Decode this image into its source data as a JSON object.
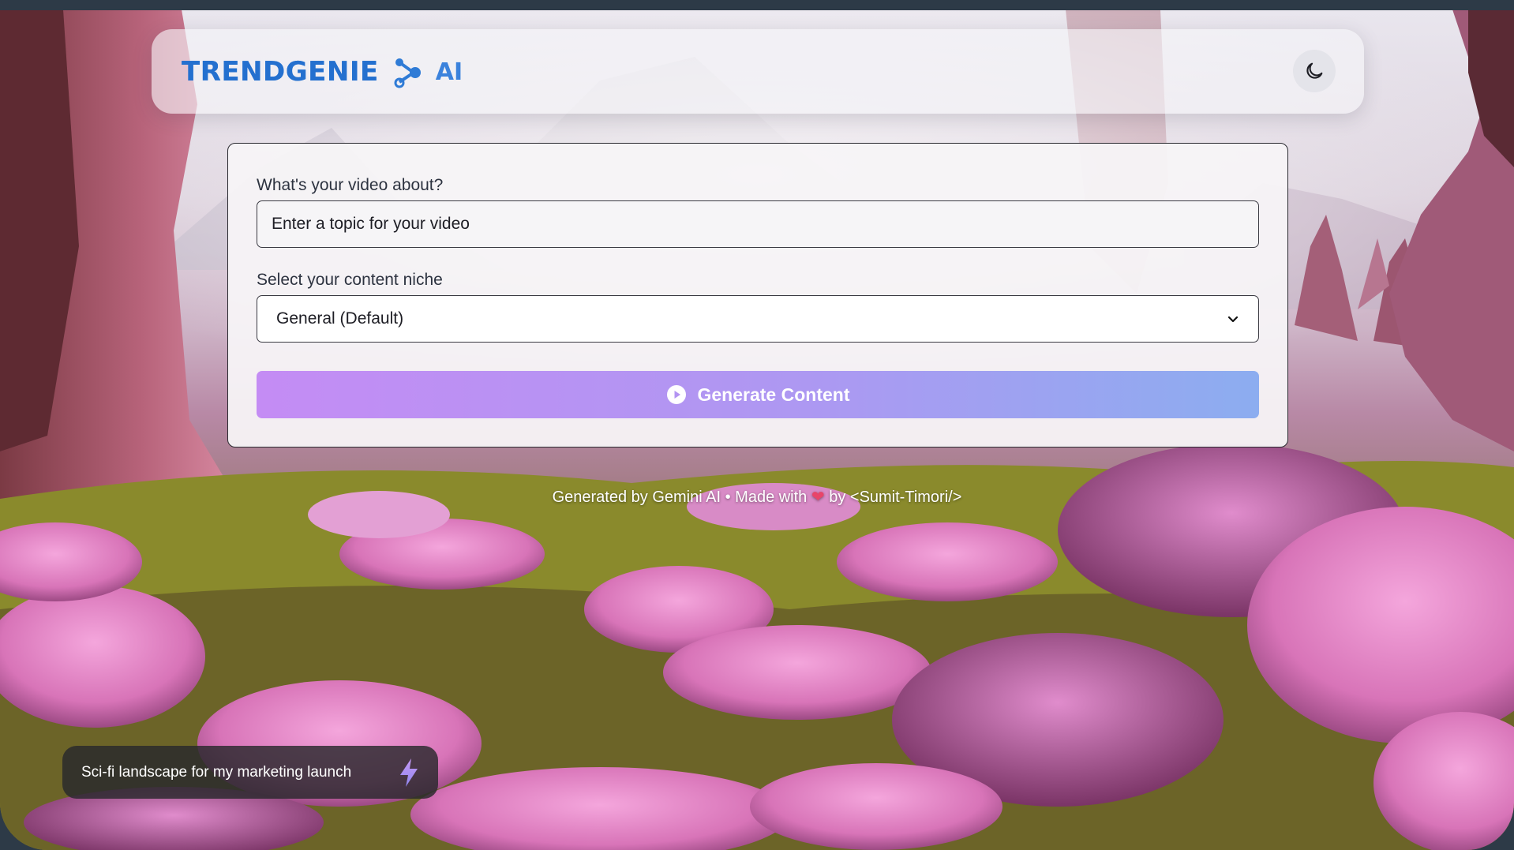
{
  "header": {
    "brand": "TRENDGENIE",
    "brand_suffix": "AI",
    "theme_toggle_icon": "moon-icon"
  },
  "form": {
    "topic_label": "What's your video about?",
    "topic_placeholder": "Enter a topic for your video",
    "topic_value": "",
    "niche_label": "Select your content niche",
    "niche_selected": "General (Default)",
    "generate_label": "Generate Content"
  },
  "footer": {
    "part1": "Generated by Gemini AI • Made with",
    "heart": "❤",
    "part2": "by <Sumit-Timori/>"
  },
  "prompt_chip": {
    "text": "Sci-fi landscape for my marketing launch",
    "icon": "lightning-icon"
  },
  "colors": {
    "brand_blue": "#2470cf",
    "button_gradient_start": "#c48cf4",
    "button_gradient_end": "#8cadf0",
    "heart": "#e8456a",
    "lightning": "#a48af0"
  }
}
